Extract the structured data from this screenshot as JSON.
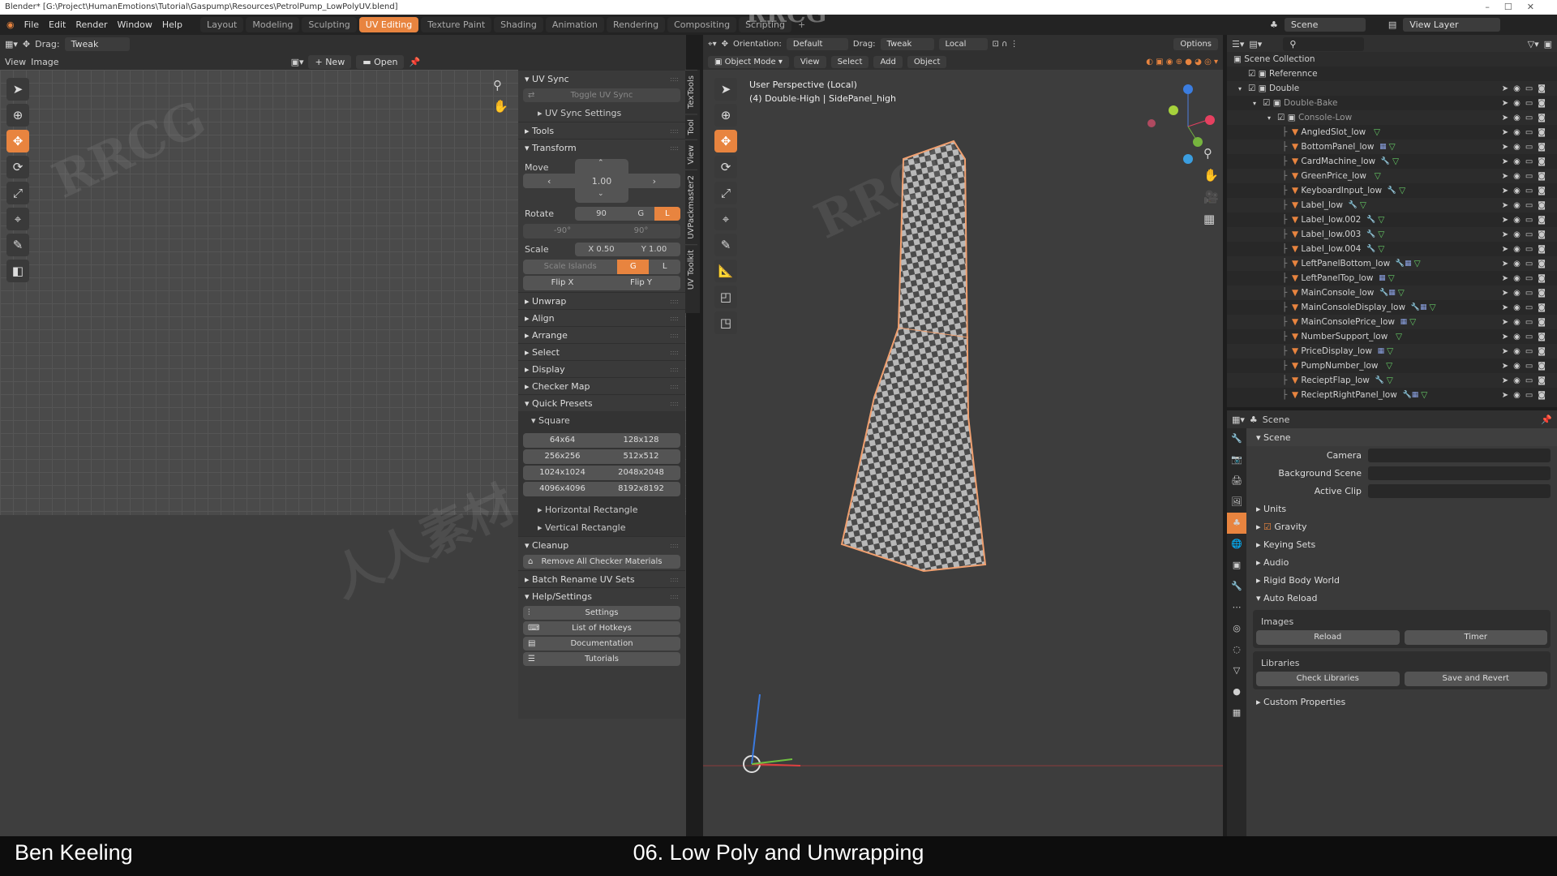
{
  "title_bar": "Blender* [G:\\Project\\HumanEmotions\\Tutorial\\Gaspump\\Resources\\PetrolPump_LowPolyUV.blend]",
  "window_controls": [
    "–",
    "☐",
    "✕"
  ],
  "menu": [
    "File",
    "Edit",
    "Render",
    "Window",
    "Help"
  ],
  "workspaces": [
    "Layout",
    "Modeling",
    "Sculpting",
    "UV Editing",
    "Texture Paint",
    "Shading",
    "Animation",
    "Rendering",
    "Compositing",
    "Scripting"
  ],
  "active_workspace": "UV Editing",
  "accent": "#e8843f",
  "scene": {
    "label": "Scene",
    "view_layer": "View Layer"
  },
  "uv_editor": {
    "drag_label": "Drag:",
    "drag_value": "Tweak",
    "menus": [
      "View",
      "Image"
    ],
    "new": "New",
    "open": "Open"
  },
  "npanel": {
    "uv_sync": "UV Sync",
    "toggle_uv_sync": "Toggle UV Sync",
    "uv_sync_settings": "UV Sync Settings",
    "tools": "Tools",
    "transform": "Transform",
    "move_label": "Move",
    "move_value": "1.00",
    "rotate_label": "Rotate",
    "rotate_value": "90",
    "g": "G",
    "l": "L",
    "rot_neg": "-90°",
    "rot_pos": "90°",
    "scale_label": "Scale",
    "scale_x": "X  0.50",
    "scale_y": "Y  1.00",
    "scale_islands": "Scale Islands",
    "flip_x": "Flip X",
    "flip_y": "Flip Y",
    "sections": [
      "Unwrap",
      "Align",
      "Arrange",
      "Select",
      "Display",
      "Checker Map"
    ],
    "quick_presets": "Quick Presets",
    "square": "Square",
    "presets": [
      [
        "64x64",
        "128x128"
      ],
      [
        "256x256",
        "512x512"
      ],
      [
        "1024x1024",
        "2048x2048"
      ],
      [
        "4096x4096",
        "8192x8192"
      ]
    ],
    "horizontal_rect": "Horizontal Rectangle",
    "vertical_rect": "Vertical Rectangle",
    "cleanup": "Cleanup",
    "remove_checker": "Remove All Checker Materials",
    "batch_rename": "Batch Rename UV Sets",
    "help_settings": "Help/Settings",
    "help_buttons": [
      "Settings",
      "List of Hotkeys",
      "Documentation",
      "Tutorials"
    ]
  },
  "side_tabs": [
    "TexTools",
    "Tool",
    "View",
    "UVPackmaster2",
    "UV Toolkit"
  ],
  "viewport": {
    "orientation_label": "Orientation:",
    "orientation": "Default",
    "drag_label": "Drag:",
    "drag": "Tweak",
    "pivot": "Local",
    "options": "Options",
    "mode": "Object Mode",
    "menus": [
      "View",
      "Select",
      "Add",
      "Object"
    ],
    "info_line1": "User Perspective (Local)",
    "info_line2": "(4) Double-High | SidePanel_high"
  },
  "outliner": {
    "root": "Scene Collection",
    "items": [
      {
        "name": "Referennce",
        "depth": 1,
        "type": "collection"
      },
      {
        "name": "Double",
        "depth": 1,
        "type": "collection"
      },
      {
        "name": "Double-Bake",
        "depth": 2,
        "type": "collection"
      },
      {
        "name": "Console-Low",
        "depth": 3,
        "type": "collection"
      },
      {
        "name": "AngledSlot_low",
        "depth": 4,
        "type": "mesh",
        "mods": ""
      },
      {
        "name": "BottomPanel_low",
        "depth": 4,
        "type": "mesh",
        "mods": "▦"
      },
      {
        "name": "CardMachine_low",
        "depth": 4,
        "type": "mesh",
        "mods": "🔧"
      },
      {
        "name": "GreenPrice_low",
        "depth": 4,
        "type": "mesh",
        "mods": ""
      },
      {
        "name": "KeyboardInput_low",
        "depth": 4,
        "type": "mesh",
        "mods": "🔧"
      },
      {
        "name": "Label_low",
        "depth": 4,
        "type": "mesh",
        "mods": "🔧"
      },
      {
        "name": "Label_low.002",
        "depth": 4,
        "type": "mesh",
        "mods": "🔧"
      },
      {
        "name": "Label_low.003",
        "depth": 4,
        "type": "mesh",
        "mods": "🔧"
      },
      {
        "name": "Label_low.004",
        "depth": 4,
        "type": "mesh",
        "mods": "🔧"
      },
      {
        "name": "LeftPanelBottom_low",
        "depth": 4,
        "type": "mesh",
        "mods": "🔧▦"
      },
      {
        "name": "LeftPanelTop_low",
        "depth": 4,
        "type": "mesh",
        "mods": "▦"
      },
      {
        "name": "MainConsole_low",
        "depth": 4,
        "type": "mesh",
        "mods": "🔧▦"
      },
      {
        "name": "MainConsoleDisplay_low",
        "depth": 4,
        "type": "mesh",
        "mods": "🔧▦"
      },
      {
        "name": "MainConsolePrice_low",
        "depth": 4,
        "type": "mesh",
        "mods": "▦"
      },
      {
        "name": "NumberSupport_low",
        "depth": 4,
        "type": "mesh",
        "mods": ""
      },
      {
        "name": "PriceDisplay_low",
        "depth": 4,
        "type": "mesh",
        "mods": "▦"
      },
      {
        "name": "PumpNumber_low",
        "depth": 4,
        "type": "mesh",
        "mods": ""
      },
      {
        "name": "RecieptFlap_low",
        "depth": 4,
        "type": "mesh",
        "mods": "🔧"
      },
      {
        "name": "RecieptRightPanel_low",
        "depth": 4,
        "type": "mesh",
        "mods": "🔧▦"
      }
    ]
  },
  "properties": {
    "header": "Scene",
    "scene_section": "Scene",
    "camera": "Camera",
    "background_scene": "Background Scene",
    "active_clip": "Active Clip",
    "sections": [
      "Units",
      "Gravity",
      "Keying Sets",
      "Audio",
      "Rigid Body World"
    ],
    "gravity_checked": true,
    "auto_reload": "Auto Reload",
    "images": "Images",
    "reload": "Reload",
    "timer": "Timer",
    "libraries": "Libraries",
    "check_libraries": "Check Libraries",
    "save_revert": "Save and Revert",
    "custom_props": "Custom Properties"
  },
  "watermark": [
    "RRCG",
    "人人素材"
  ],
  "caption": {
    "author": "Ben Keeling",
    "lesson": "06. Low Poly and Unwrapping"
  }
}
